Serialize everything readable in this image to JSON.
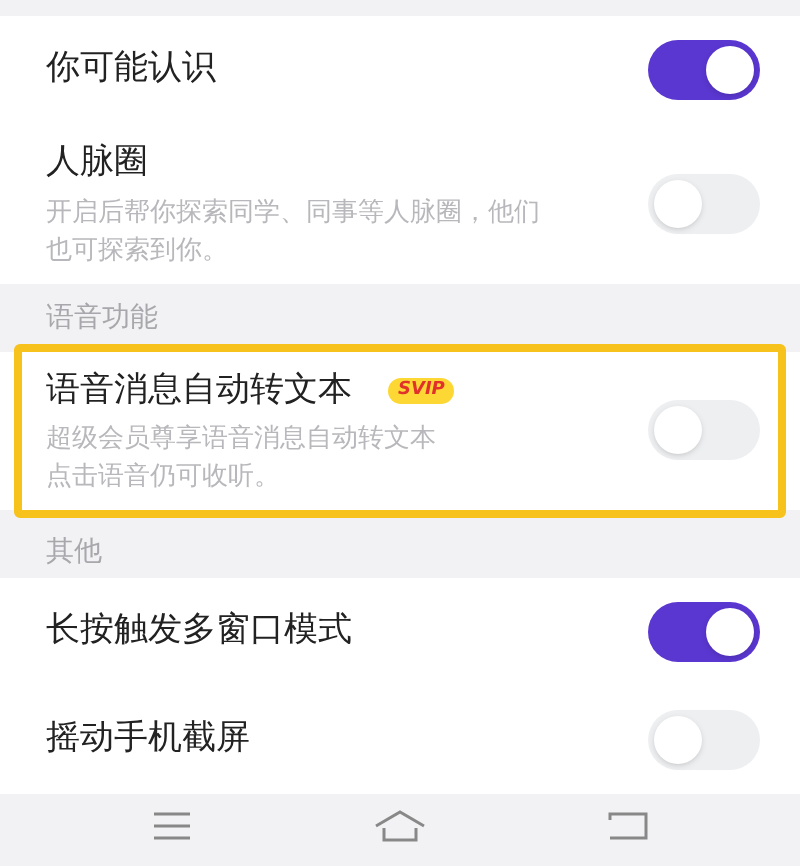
{
  "sections": [
    {
      "rows": [
        {
          "label": "你可能认识",
          "on": true
        },
        {
          "label": "人脉圈",
          "description": "开启后帮你探索同学、同事等人脉圈，他们也可探索到你。",
          "on": false
        }
      ]
    },
    {
      "title": "语音功能",
      "rows": [
        {
          "label": "语音消息自动转文本",
          "badge": "SVIP",
          "description": "超级会员尊享语音消息自动转文本点击语音仍可收听。",
          "on": false,
          "highlighted": true
        }
      ]
    },
    {
      "title": "其他",
      "rows": [
        {
          "label": "长按触发多窗口模式",
          "on": true
        },
        {
          "label": "摇动手机截屏",
          "on": false
        }
      ]
    }
  ]
}
